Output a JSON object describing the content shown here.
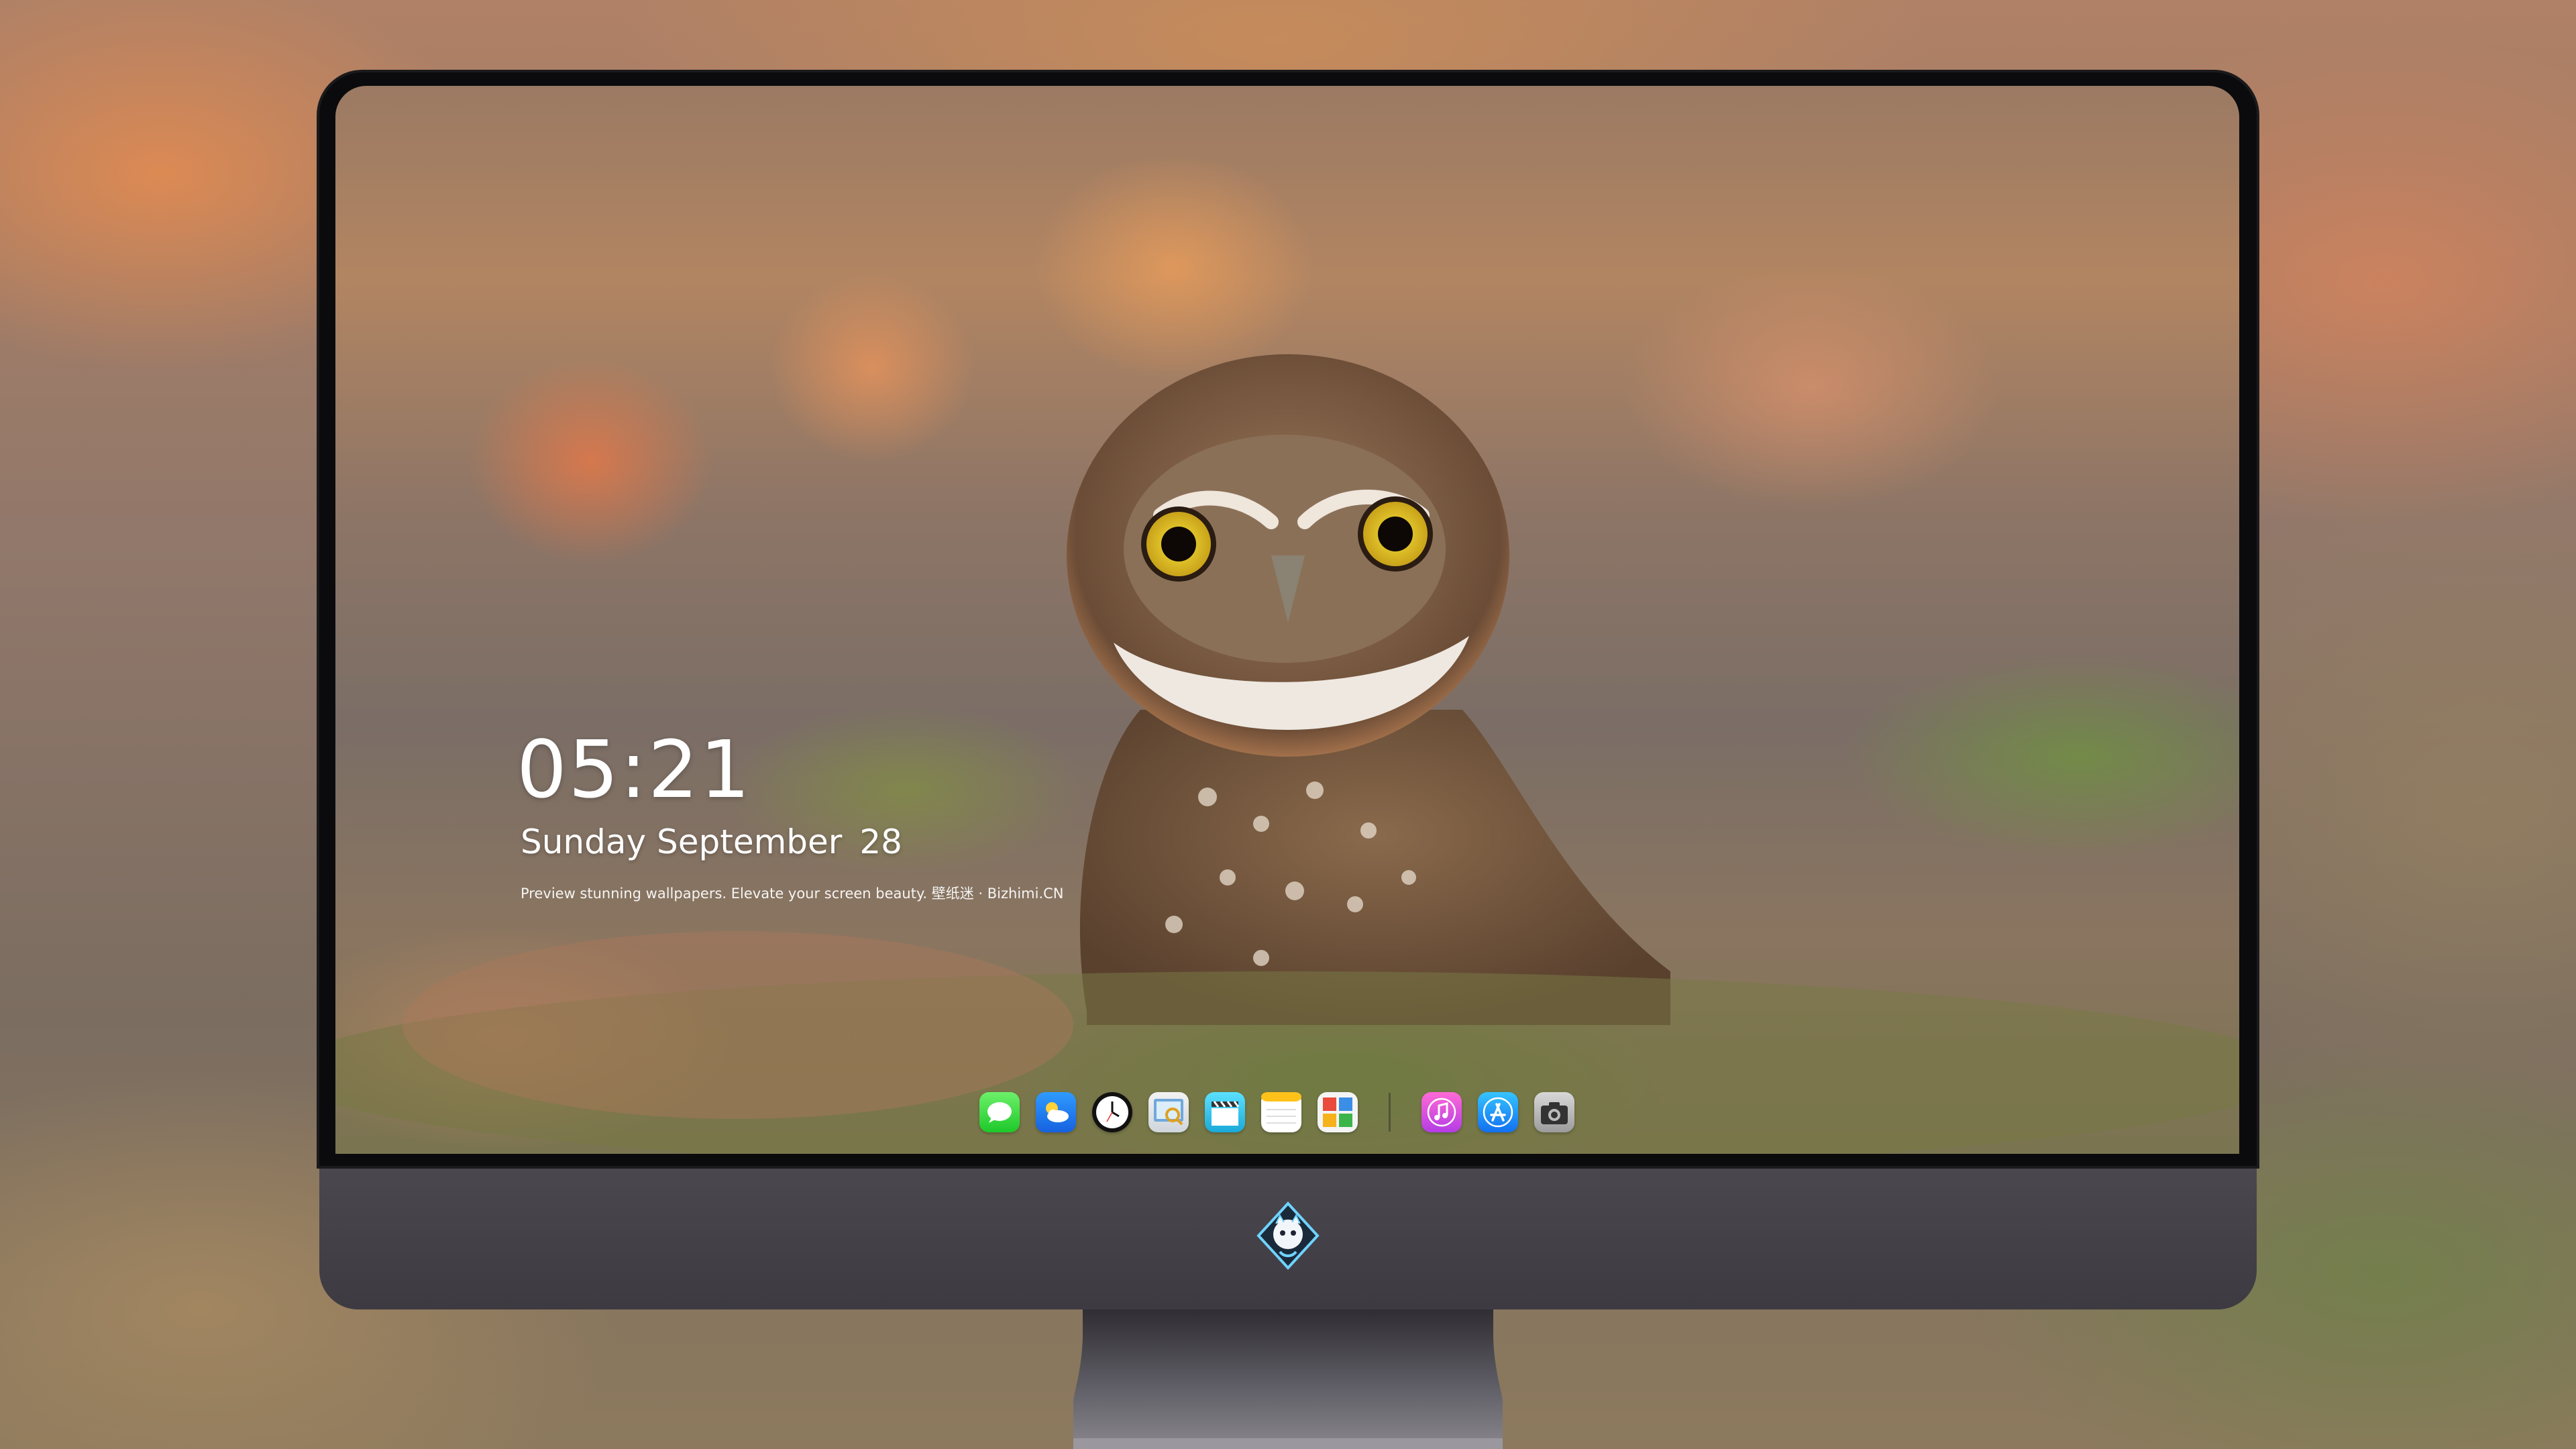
{
  "lockscreen": {
    "time": "05:21",
    "day": "Sunday",
    "month": "September",
    "date": "28",
    "caption": "Preview stunning wallpapers. Elevate your screen beauty. 壁纸迷 · Bizhimi.CN"
  },
  "dock": {
    "apps": [
      {
        "name": "Messages",
        "icon": "messages-icon"
      },
      {
        "name": "Weather",
        "icon": "weather-icon"
      },
      {
        "name": "Clock",
        "icon": "clock-icon"
      },
      {
        "name": "Preview",
        "icon": "preview-icon"
      },
      {
        "name": "Clips",
        "icon": "clapperboard-icon"
      },
      {
        "name": "Notes",
        "icon": "notes-icon"
      },
      {
        "name": "Photo Booth",
        "icon": "photo-grid-icon"
      },
      {
        "name": "Music",
        "icon": "music-icon"
      },
      {
        "name": "App Store",
        "icon": "app-store-icon"
      },
      {
        "name": "Camera",
        "icon": "camera-icon"
      }
    ]
  },
  "colors": {
    "bezel": "#0b0b0d",
    "chin": "#433f47",
    "clock_text": "#ffffff"
  }
}
